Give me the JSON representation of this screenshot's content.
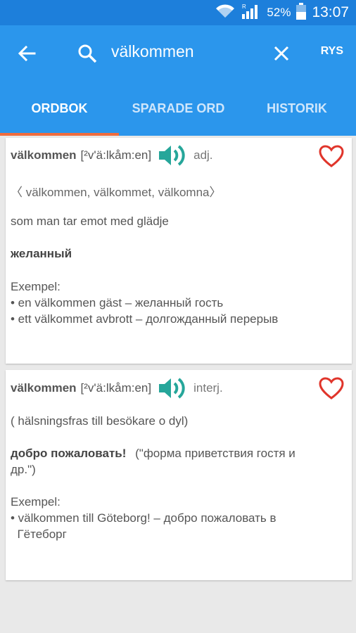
{
  "status": {
    "battery": "52%",
    "time": "13:07",
    "icons": [
      "wifi-icon",
      "signal-icon",
      "battery-icon"
    ]
  },
  "search": {
    "query": "välkommen",
    "lang": "RYS"
  },
  "tabs": [
    {
      "label": "ORDBOK",
      "active": true
    },
    {
      "label": "SPARADE ORD",
      "active": false
    },
    {
      "label": "HISTORIK",
      "active": false
    }
  ],
  "entries": [
    {
      "word": "välkommen",
      "pron": "[²v'ä:lkåm:en]",
      "pos": "adj.",
      "forms": "〈 välkommen, välkommet, välkomna〉",
      "definition": "som man tar emot med glädje",
      "translation": "желанный",
      "examples_label": "Exempel:",
      "examples": [
        "• en välkommen gäst – желанный гость",
        "• ett välkommet avbrott – долгожданный перерыв"
      ]
    },
    {
      "word": "välkommen",
      "pron": "[²v'ä:lkåm:en]",
      "pos": "interj.",
      "note": "( hälsningsfras till besökare o dyl)",
      "translation": "добро пожаловать!",
      "translation_note_1": "(\"форма приветствия гостя и",
      "translation_note_2": "др.\")",
      "examples_label": "Exempel:",
      "examples": [
        "• välkommen till Göteborg! – добро пожаловать в",
        "  Гётеборг"
      ]
    }
  ],
  "colors": {
    "statusbar": "#1d7fdb",
    "appbar": "#2b96ec",
    "indicator": "#ef6c3d",
    "speaker": "#26a69a",
    "heart": "#e0352b"
  }
}
